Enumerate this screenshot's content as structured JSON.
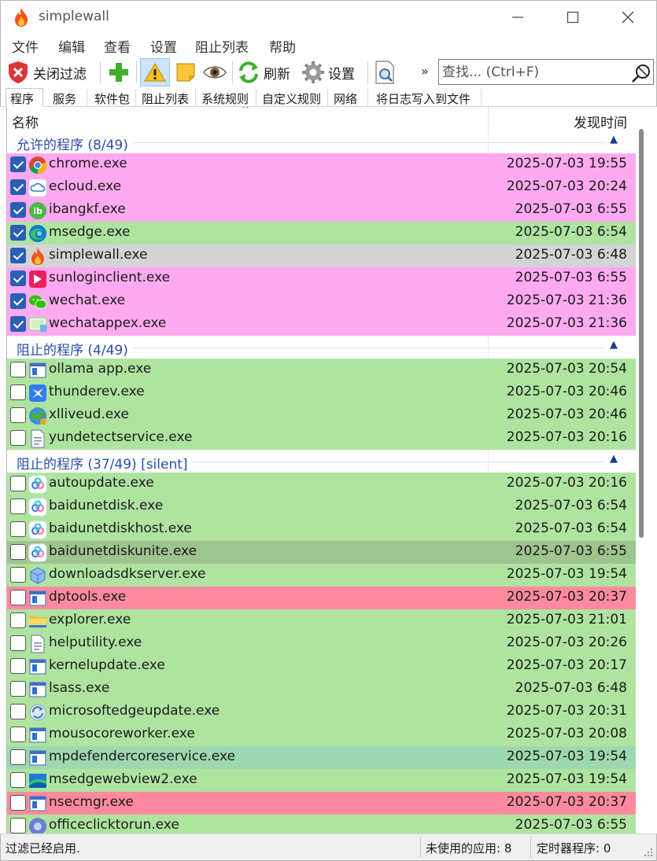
{
  "window": {
    "title": "simplewall"
  },
  "menu": [
    "文件",
    "编辑",
    "查看",
    "设置",
    "阻止列表",
    "帮助"
  ],
  "toolbar": {
    "disable_filters": "关闭过滤",
    "refresh": "刷新",
    "settings": "设置",
    "overflow": "»",
    "search_placeholder": "查找... (Ctrl+F)"
  },
  "tabs": [
    "程序",
    "服务",
    "软件包",
    "阻止列表",
    "系统规则",
    "自定义规则",
    "网络",
    "将日志写入到文件"
  ],
  "columns": {
    "name": "名称",
    "time": "发现时间"
  },
  "colors": {
    "pink": "#ffaaf0",
    "green": "#aee4a0",
    "gray": "#d4d4d4",
    "red": "#ff8aa0",
    "dark_green": "#9ec490",
    "teal_green": "#9ed8b0"
  },
  "groups": [
    {
      "label": "允许的程序 (8/49)",
      "rows": [
        {
          "name": "chrome.exe",
          "time": "2025-07-03 19:55",
          "checked": true,
          "bg": "#ffaaf0",
          "icon": "chrome-icon"
        },
        {
          "name": "ecloud.exe",
          "time": "2025-07-03 20:24",
          "checked": true,
          "bg": "#ffaaf0",
          "icon": "cloud-icon"
        },
        {
          "name": "ibangkf.exe",
          "time": "2025-07-03 6:55",
          "checked": true,
          "bg": "#ffaaf0",
          "icon": "ibangkf-icon"
        },
        {
          "name": "msedge.exe",
          "time": "2025-07-03 6:54",
          "checked": true,
          "bg": "#aee4a0",
          "icon": "edge-icon"
        },
        {
          "name": "simplewall.exe",
          "time": "2025-07-03 6:48",
          "checked": true,
          "bg": "#d4d4d4",
          "icon": "flame-icon"
        },
        {
          "name": "sunloginclient.exe",
          "time": "2025-07-03 6:55",
          "checked": true,
          "bg": "#ffaaf0",
          "icon": "sunlogin-icon"
        },
        {
          "name": "wechat.exe",
          "time": "2025-07-03 21:36",
          "checked": true,
          "bg": "#ffaaf0",
          "icon": "wechat-icon"
        },
        {
          "name": "wechatappex.exe",
          "time": "2025-07-03 21:36",
          "checked": true,
          "bg": "#ffaaf0",
          "icon": "wechat-app-icon"
        }
      ]
    },
    {
      "label": "阻止的程序 (4/49)",
      "rows": [
        {
          "name": "ollama app.exe",
          "time": "2025-07-03 20:54",
          "checked": false,
          "bg": "#aee4a0",
          "icon": "app-window-icon"
        },
        {
          "name": "thunderev.exe",
          "time": "2025-07-03 20:46",
          "checked": false,
          "bg": "#aee4a0",
          "icon": "thunder-icon"
        },
        {
          "name": "xlliveud.exe",
          "time": "2025-07-03 20:46",
          "checked": false,
          "bg": "#aee4a0",
          "icon": "globe-icon"
        },
        {
          "name": "yundetectservice.exe",
          "time": "2025-07-03 20:16",
          "checked": false,
          "bg": "#aee4a0",
          "icon": "document-icon"
        }
      ]
    },
    {
      "label": "阻止的程序 (37/49) [silent]",
      "rows": [
        {
          "name": "autoupdate.exe",
          "time": "2025-07-03 20:16",
          "checked": false,
          "bg": "#aee4a0",
          "icon": "baidu-cloud-icon"
        },
        {
          "name": "baidunetdisk.exe",
          "time": "2025-07-03 6:54",
          "checked": false,
          "bg": "#aee4a0",
          "icon": "baidu-cloud-icon"
        },
        {
          "name": "baidunetdiskhost.exe",
          "time": "2025-07-03 6:54",
          "checked": false,
          "bg": "#aee4a0",
          "icon": "baidu-cloud-icon"
        },
        {
          "name": "baidunetdiskunite.exe",
          "time": "2025-07-03 6:55",
          "checked": false,
          "bg": "#9ec490",
          "icon": "baidu-cloud-icon"
        },
        {
          "name": "downloadsdkserver.exe",
          "time": "2025-07-03 19:54",
          "checked": false,
          "bg": "#aee4a0",
          "icon": "box-icon"
        },
        {
          "name": "dptools.exe",
          "time": "2025-07-03 20:37",
          "checked": false,
          "bg": "#ff8aa0",
          "icon": "app-window-icon"
        },
        {
          "name": "explorer.exe",
          "time": "2025-07-03 21:01",
          "checked": false,
          "bg": "#aee4a0",
          "icon": "folder-icon"
        },
        {
          "name": "helputility.exe",
          "time": "2025-07-03 20:26",
          "checked": false,
          "bg": "#aee4a0",
          "icon": "document-icon"
        },
        {
          "name": "kernelupdate.exe",
          "time": "2025-07-03 20:17",
          "checked": false,
          "bg": "#aee4a0",
          "icon": "app-window-icon"
        },
        {
          "name": "lsass.exe",
          "time": "2025-07-03 6:48",
          "checked": false,
          "bg": "#aee4a0",
          "icon": "app-window-icon"
        },
        {
          "name": "microsoftedgeupdate.exe",
          "time": "2025-07-03 20:31",
          "checked": false,
          "bg": "#aee4a0",
          "icon": "edge-update-icon"
        },
        {
          "name": "mousocoreworker.exe",
          "time": "2025-07-03 20:08",
          "checked": false,
          "bg": "#aee4a0",
          "icon": "app-window-icon"
        },
        {
          "name": "mpdefendercoreservice.exe",
          "time": "2025-07-03 19:54",
          "checked": false,
          "bg": "#9ed8b0",
          "icon": "app-window-icon"
        },
        {
          "name": "msedgewebview2.exe",
          "time": "2025-07-03 19:54",
          "checked": false,
          "bg": "#aee4a0",
          "icon": "webview-icon"
        },
        {
          "name": "nsecmgr.exe",
          "time": "2025-07-03 20:37",
          "checked": false,
          "bg": "#ff8aa0",
          "icon": "app-window-icon"
        },
        {
          "name": "officeclicktorun.exe",
          "time": "2025-07-03 6:55",
          "checked": false,
          "bg": "#aee4a0",
          "icon": "office-icon"
        }
      ]
    }
  ],
  "status": {
    "filter": "过滤已经启用.",
    "unused": "未使用的应用: 8",
    "timer": "定时器程序: 0"
  }
}
